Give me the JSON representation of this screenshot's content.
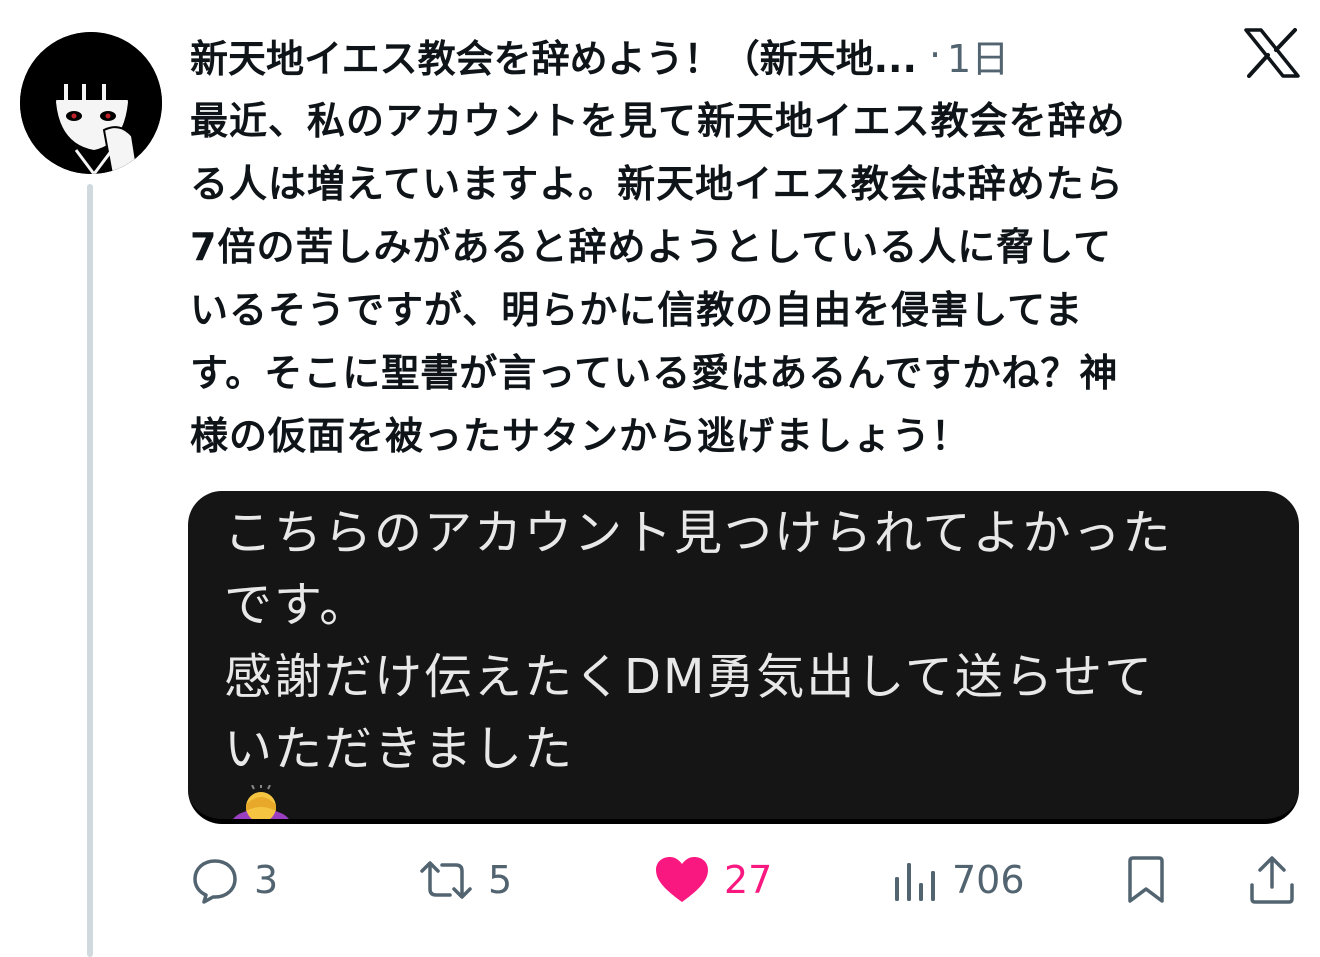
{
  "post": {
    "author_name": "新天地イエス教会を辞めよう！（新天地...",
    "separator": "·",
    "time": "1日",
    "text_lines": [
      "最近、私のアカウントを見て新天地イエス教会を辞め",
      "る人は増えていますよ。新天地イエス教会は辞めたら",
      "7倍の苦しみがあると辞めようとしている人に脅して",
      "いるそうですが、明らかに信教の自由を侵害してま",
      "す。そこに聖書が言っている愛はあるんですかね？神",
      "様の仮面を被ったサタンから逃げましょう！"
    ]
  },
  "media": {
    "lines": [
      "こちらのアカウント見つけられてよかった",
      "です。",
      "感謝だけ伝えたくDM勇気出して送らせて",
      "いただきました"
    ],
    "emoji": "person-bowing-emoji"
  },
  "actions": {
    "reply_count": "3",
    "repost_count": "5",
    "like_count": "27",
    "views_count": "706",
    "liked": true,
    "like_color": "#f91880"
  },
  "icons": {
    "platform": "x-logo-icon",
    "reply": "reply-icon",
    "repost": "repost-icon",
    "like": "heart-icon",
    "views": "views-icon",
    "bookmark": "bookmark-icon",
    "share": "share-icon"
  },
  "colors": {
    "text_primary": "#0f1419",
    "text_secondary": "#536471",
    "thread_line": "#cfd9de",
    "media_background": "#151515",
    "like": "#f91880"
  }
}
